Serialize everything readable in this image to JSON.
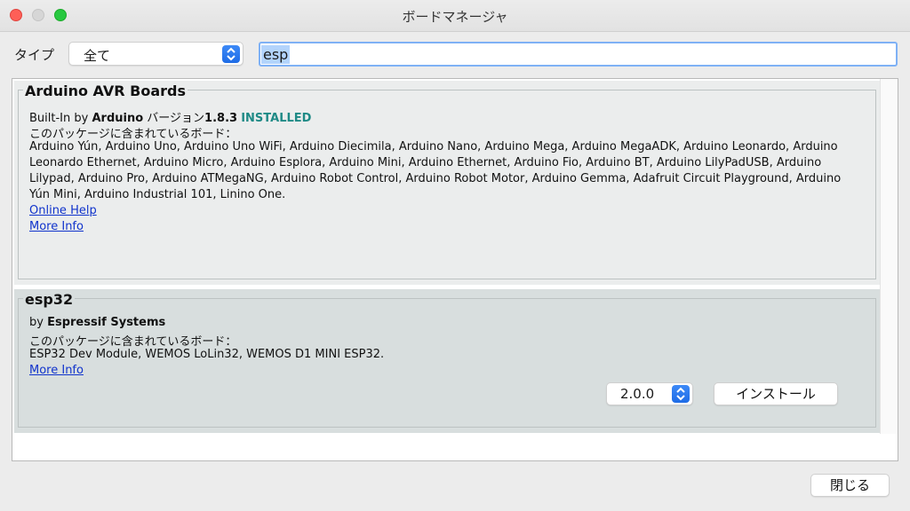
{
  "window": {
    "title": "ボードマネージャ"
  },
  "filter": {
    "type_label": "タイプ",
    "type_value": "全て",
    "search_value": "esp"
  },
  "boards": [
    {
      "name": "Arduino AVR Boards",
      "by_prefix": "Built-In by",
      "author": "Arduino",
      "version_prefix": "バージョン",
      "version": "1.8.3",
      "status": "INSTALLED",
      "included_label": "このパッケージに含まれているボード：",
      "boards_lines": [
        "Arduino Yún, Arduino Uno, Arduino Uno WiFi, Arduino Diecimila, Arduino Nano, Arduino Mega, Arduino MegaADK, Arduino Leonardo, Arduino",
        "Leonardo Ethernet, Arduino Micro, Arduino Esplora, Arduino Mini, Arduino Ethernet, Arduino Fio, Arduino BT, Arduino LilyPadUSB, Arduino",
        "Lilypad, Arduino Pro, Arduino ATMegaNG, Arduino Robot Control, Arduino Robot Motor, Arduino Gemma, Adafruit Circuit Playground, Arduino",
        "Yún Mini, Arduino Industrial 101, Linino One."
      ],
      "online_help": "Online Help",
      "more_info": "More Info"
    },
    {
      "name": "esp32",
      "by_prefix": "by",
      "author": "Espressif Systems",
      "included_label": "このパッケージに含まれているボード：",
      "boards_lines": [
        "ESP32 Dev Module, WEMOS LoLin32, WEMOS D1 MINI ESP32."
      ],
      "more_info": "More Info",
      "version_select": "2.0.0",
      "install_label": "インストール"
    }
  ],
  "footer": {
    "close_label": "閉じる"
  },
  "colors": {
    "installed": "#1f8a86",
    "link": "#1033cc",
    "accent": "#1f6ce6"
  }
}
